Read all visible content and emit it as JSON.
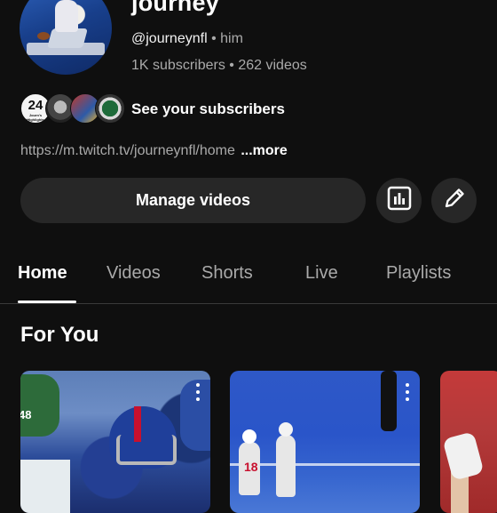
{
  "channel": {
    "name": "journey",
    "handle": "@journeynfl",
    "separator": "•",
    "pronouns": "him",
    "subscribers": "1K subscribers",
    "videos": "262 videos",
    "see_subscribers": "See your subscribers",
    "link": "https://m.twitch.tv/journeynfl/home",
    "more": "...more",
    "sub_avatar_1_text": "24",
    "sub_avatar_1_small": "Journ's Highlights"
  },
  "actions": {
    "manage_videos": "Manage videos",
    "analytics_icon": "bar-chart-icon",
    "edit_icon": "pencil-icon"
  },
  "tabs": [
    {
      "label": "Home",
      "active": true
    },
    {
      "label": "Videos"
    },
    {
      "label": "Shorts"
    },
    {
      "label": "Live"
    },
    {
      "label": "Playlists"
    }
  ],
  "section": {
    "title": "For You"
  },
  "thumb_texts": {
    "t1_num": "48",
    "t2_num": "18"
  },
  "colors": {
    "background": "#0f0f0f",
    "button": "#272727",
    "secondary_text": "#aaaaaa"
  }
}
